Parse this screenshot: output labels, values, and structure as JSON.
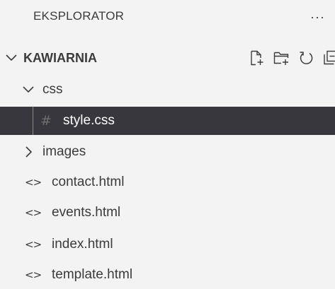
{
  "header": {
    "title": "EKSPLORATOR",
    "more_icon": "ellipsis-icon",
    "more_glyph": "···"
  },
  "root": {
    "label": "KAWIARNIA",
    "expanded": true,
    "toolbar": [
      "new-file-icon",
      "new-folder-icon",
      "refresh-icon",
      "collapse-all-icon"
    ]
  },
  "tree": {
    "css_folder": {
      "label": "css",
      "expanded": true
    },
    "style_file": {
      "label": "style.css",
      "icon_glyph": "#",
      "selected": true
    },
    "images_folder": {
      "label": "images",
      "expanded": false
    },
    "files": [
      {
        "label": "contact.html",
        "icon_glyph": "<>"
      },
      {
        "label": "events.html",
        "icon_glyph": "<>"
      },
      {
        "label": "index.html",
        "icon_glyph": "<>"
      },
      {
        "label": "template.html",
        "icon_glyph": "<>"
      }
    ]
  },
  "colors": {
    "background": "#f3f3f3",
    "selected_background": "#37373d",
    "text": "#3b3b3b",
    "selected_text": "#ffffff"
  }
}
